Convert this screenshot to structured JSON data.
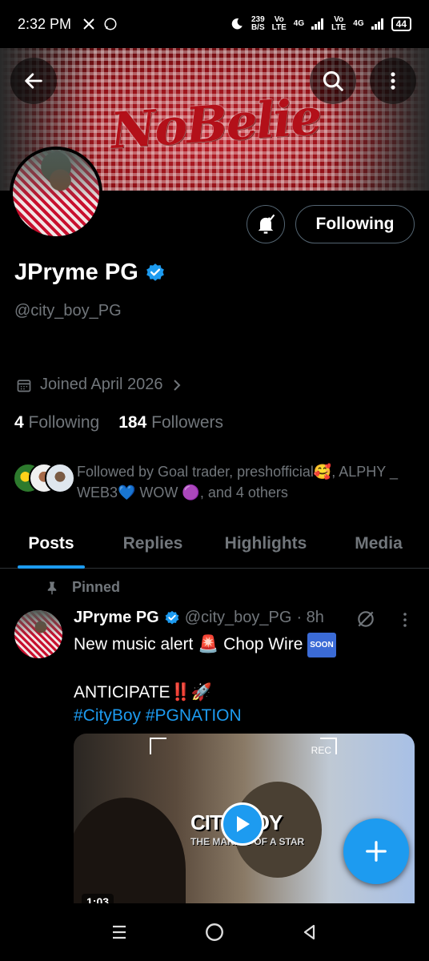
{
  "status_bar": {
    "time": "2:32 PM",
    "left_icons": [
      "x-logo-icon",
      "whatsapp-icon"
    ],
    "data_speed_value": "239",
    "data_speed_unit": "B/S",
    "sim1_vo": "Vo",
    "sim1_lte": "LTE",
    "sim1_net": "4G",
    "sim2_vo": "Vo",
    "sim2_lte": "LTE",
    "sim2_net": "4G",
    "battery": "44"
  },
  "header": {
    "banner_text": "NoBelie",
    "back_icon": "back-arrow-icon",
    "search_icon": "search-icon",
    "more_icon": "more-vertical-icon"
  },
  "profile": {
    "name": "JPryme PG",
    "handle": "@city_boy_PG",
    "joined": "Joined April 2026",
    "following_count": "4",
    "following_label": "Following",
    "followers_count": "184",
    "followers_label": "Followers",
    "followed_by": "Followed by Goal trader, preshofficial🥰, ALPHY _ WEB3💙 WOW 🟣, and 4 others",
    "follow_button": "Following"
  },
  "tabs": [
    {
      "label": "Posts",
      "active": true
    },
    {
      "label": "Replies",
      "active": false
    },
    {
      "label": "Highlights",
      "active": false
    },
    {
      "label": "Media",
      "active": false
    }
  ],
  "tweet": {
    "pinned_label": "Pinned",
    "author_name": "JPryme PG",
    "author_handle": "@city_boy_PG",
    "time": "· 8h",
    "text_line1": "New music alert 🚨 Chop Wire",
    "soon_badge": "SOON",
    "text_line2": "ANTICIPATE‼️🚀",
    "hashtags": "#CityBoy #PGNATION",
    "media_title": "CITY BOY",
    "media_subtitle": "THE MAKING OF A STAR",
    "media_rec": "REC",
    "media_duration": "1:03"
  },
  "colors": {
    "accent": "#1d9bf0",
    "muted": "#71767b",
    "background": "#000000"
  }
}
